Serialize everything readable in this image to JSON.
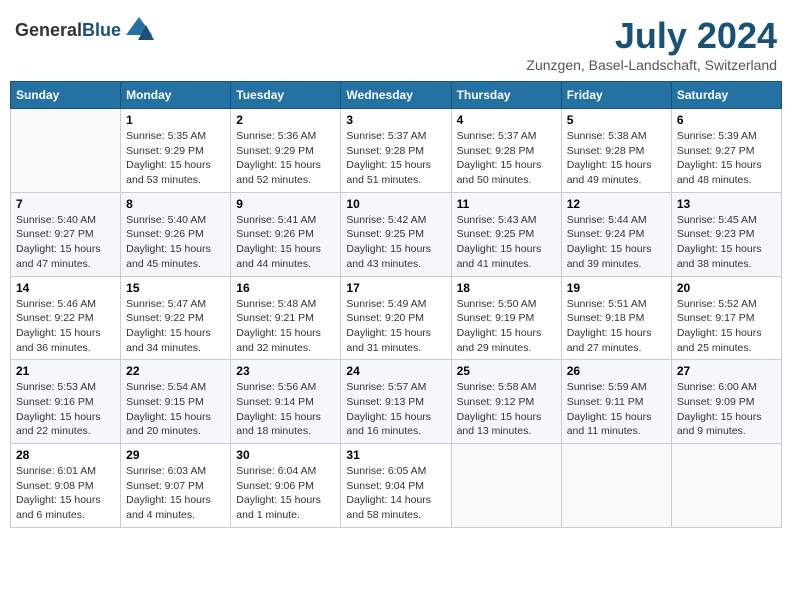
{
  "header": {
    "logo_general": "General",
    "logo_blue": "Blue",
    "month": "July 2024",
    "location": "Zunzgen, Basel-Landschaft, Switzerland"
  },
  "weekdays": [
    "Sunday",
    "Monday",
    "Tuesday",
    "Wednesday",
    "Thursday",
    "Friday",
    "Saturday"
  ],
  "weeks": [
    [
      {
        "day": "",
        "info": ""
      },
      {
        "day": "1",
        "info": "Sunrise: 5:35 AM\nSunset: 9:29 PM\nDaylight: 15 hours\nand 53 minutes."
      },
      {
        "day": "2",
        "info": "Sunrise: 5:36 AM\nSunset: 9:29 PM\nDaylight: 15 hours\nand 52 minutes."
      },
      {
        "day": "3",
        "info": "Sunrise: 5:37 AM\nSunset: 9:28 PM\nDaylight: 15 hours\nand 51 minutes."
      },
      {
        "day": "4",
        "info": "Sunrise: 5:37 AM\nSunset: 9:28 PM\nDaylight: 15 hours\nand 50 minutes."
      },
      {
        "day": "5",
        "info": "Sunrise: 5:38 AM\nSunset: 9:28 PM\nDaylight: 15 hours\nand 49 minutes."
      },
      {
        "day": "6",
        "info": "Sunrise: 5:39 AM\nSunset: 9:27 PM\nDaylight: 15 hours\nand 48 minutes."
      }
    ],
    [
      {
        "day": "7",
        "info": "Sunrise: 5:40 AM\nSunset: 9:27 PM\nDaylight: 15 hours\nand 47 minutes."
      },
      {
        "day": "8",
        "info": "Sunrise: 5:40 AM\nSunset: 9:26 PM\nDaylight: 15 hours\nand 45 minutes."
      },
      {
        "day": "9",
        "info": "Sunrise: 5:41 AM\nSunset: 9:26 PM\nDaylight: 15 hours\nand 44 minutes."
      },
      {
        "day": "10",
        "info": "Sunrise: 5:42 AM\nSunset: 9:25 PM\nDaylight: 15 hours\nand 43 minutes."
      },
      {
        "day": "11",
        "info": "Sunrise: 5:43 AM\nSunset: 9:25 PM\nDaylight: 15 hours\nand 41 minutes."
      },
      {
        "day": "12",
        "info": "Sunrise: 5:44 AM\nSunset: 9:24 PM\nDaylight: 15 hours\nand 39 minutes."
      },
      {
        "day": "13",
        "info": "Sunrise: 5:45 AM\nSunset: 9:23 PM\nDaylight: 15 hours\nand 38 minutes."
      }
    ],
    [
      {
        "day": "14",
        "info": "Sunrise: 5:46 AM\nSunset: 9:22 PM\nDaylight: 15 hours\nand 36 minutes."
      },
      {
        "day": "15",
        "info": "Sunrise: 5:47 AM\nSunset: 9:22 PM\nDaylight: 15 hours\nand 34 minutes."
      },
      {
        "day": "16",
        "info": "Sunrise: 5:48 AM\nSunset: 9:21 PM\nDaylight: 15 hours\nand 32 minutes."
      },
      {
        "day": "17",
        "info": "Sunrise: 5:49 AM\nSunset: 9:20 PM\nDaylight: 15 hours\nand 31 minutes."
      },
      {
        "day": "18",
        "info": "Sunrise: 5:50 AM\nSunset: 9:19 PM\nDaylight: 15 hours\nand 29 minutes."
      },
      {
        "day": "19",
        "info": "Sunrise: 5:51 AM\nSunset: 9:18 PM\nDaylight: 15 hours\nand 27 minutes."
      },
      {
        "day": "20",
        "info": "Sunrise: 5:52 AM\nSunset: 9:17 PM\nDaylight: 15 hours\nand 25 minutes."
      }
    ],
    [
      {
        "day": "21",
        "info": "Sunrise: 5:53 AM\nSunset: 9:16 PM\nDaylight: 15 hours\nand 22 minutes."
      },
      {
        "day": "22",
        "info": "Sunrise: 5:54 AM\nSunset: 9:15 PM\nDaylight: 15 hours\nand 20 minutes."
      },
      {
        "day": "23",
        "info": "Sunrise: 5:56 AM\nSunset: 9:14 PM\nDaylight: 15 hours\nand 18 minutes."
      },
      {
        "day": "24",
        "info": "Sunrise: 5:57 AM\nSunset: 9:13 PM\nDaylight: 15 hours\nand 16 minutes."
      },
      {
        "day": "25",
        "info": "Sunrise: 5:58 AM\nSunset: 9:12 PM\nDaylight: 15 hours\nand 13 minutes."
      },
      {
        "day": "26",
        "info": "Sunrise: 5:59 AM\nSunset: 9:11 PM\nDaylight: 15 hours\nand 11 minutes."
      },
      {
        "day": "27",
        "info": "Sunrise: 6:00 AM\nSunset: 9:09 PM\nDaylight: 15 hours\nand 9 minutes."
      }
    ],
    [
      {
        "day": "28",
        "info": "Sunrise: 6:01 AM\nSunset: 9:08 PM\nDaylight: 15 hours\nand 6 minutes."
      },
      {
        "day": "29",
        "info": "Sunrise: 6:03 AM\nSunset: 9:07 PM\nDaylight: 15 hours\nand 4 minutes."
      },
      {
        "day": "30",
        "info": "Sunrise: 6:04 AM\nSunset: 9:06 PM\nDaylight: 15 hours\nand 1 minute."
      },
      {
        "day": "31",
        "info": "Sunrise: 6:05 AM\nSunset: 9:04 PM\nDaylight: 14 hours\nand 58 minutes."
      },
      {
        "day": "",
        "info": ""
      },
      {
        "day": "",
        "info": ""
      },
      {
        "day": "",
        "info": ""
      }
    ]
  ]
}
